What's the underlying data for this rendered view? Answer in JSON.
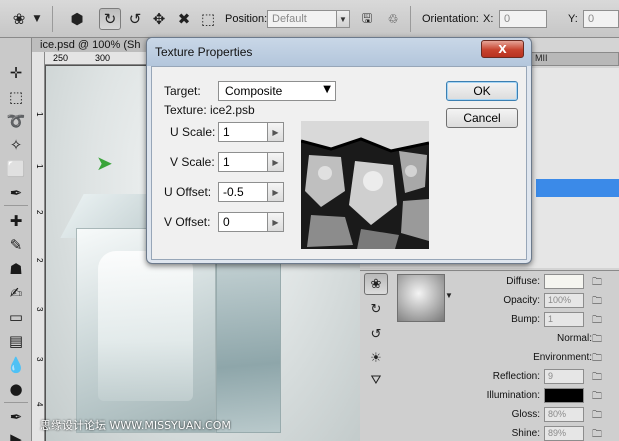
{
  "options_bar": {
    "position_label": "Position:",
    "position_value": "Default",
    "orientation_label": "Orientation:",
    "x_label": "X:",
    "x_value": "0",
    "y_label": "Y:",
    "y_value": "0"
  },
  "document": {
    "tab_title": "ice.psd @ 100% (Sh",
    "ruler_h_ticks": [
      "250",
      "300"
    ],
    "ruler_v_ticks": [
      "1",
      "1",
      "2",
      "2",
      "3",
      "3",
      "4"
    ]
  },
  "right_panel": {
    "tab_title": "MII"
  },
  "dialog": {
    "title": "Texture Properties",
    "close_label": "X",
    "target_label": "Target:",
    "target_value": "Composite",
    "texture_label": "Texture: ice2.psb",
    "u_scale_label": "U Scale:",
    "u_scale_value": "1",
    "v_scale_label": "V Scale:",
    "v_scale_value": "1",
    "u_offset_label": "U Offset:",
    "u_offset_value": "-0.5",
    "v_offset_label": "V Offset:",
    "v_offset_value": "0",
    "ok_label": "OK",
    "cancel_label": "Cancel"
  },
  "material": {
    "diffuse_label": "Diffuse:",
    "opacity_label": "Opacity:",
    "opacity_value": "100%",
    "bump_label": "Bump:",
    "bump_value": "1",
    "normal_label": "Normal:",
    "environment_label": "Environment:",
    "reflection_label": "Reflection:",
    "reflection_value": "9",
    "illumination_label": "Illumination:",
    "gloss_label": "Gloss:",
    "gloss_value": "80%",
    "shine_label": "Shine:",
    "shine_value": "89%"
  },
  "watermark": "思缘设计论坛 WWW.MISSYUAN.COM",
  "colors": {
    "selection_blue": "#3b8ae8",
    "close_red": "#c7432e",
    "dialog_bg": "#f0f0f0"
  },
  "icons": {
    "options_bar": [
      "3d-material-tool-icon",
      "3d-object-icon",
      "3d-rotate-icon",
      "3d-roll-icon",
      "3d-pan-icon",
      "3d-slide-icon",
      "3d-scale-icon",
      "save-position-icon",
      "delete-position-icon"
    ],
    "toolbox": [
      "move-icon",
      "marquee-icon",
      "lasso-icon",
      "quick-select-icon",
      "crop-icon",
      "eyedropper-icon",
      "healing-icon",
      "brush-icon",
      "clone-stamp-icon",
      "history-brush-icon",
      "eraser-icon",
      "gradient-icon",
      "blur-icon",
      "dodge-icon",
      "pen-icon",
      "path-select-icon"
    ]
  }
}
